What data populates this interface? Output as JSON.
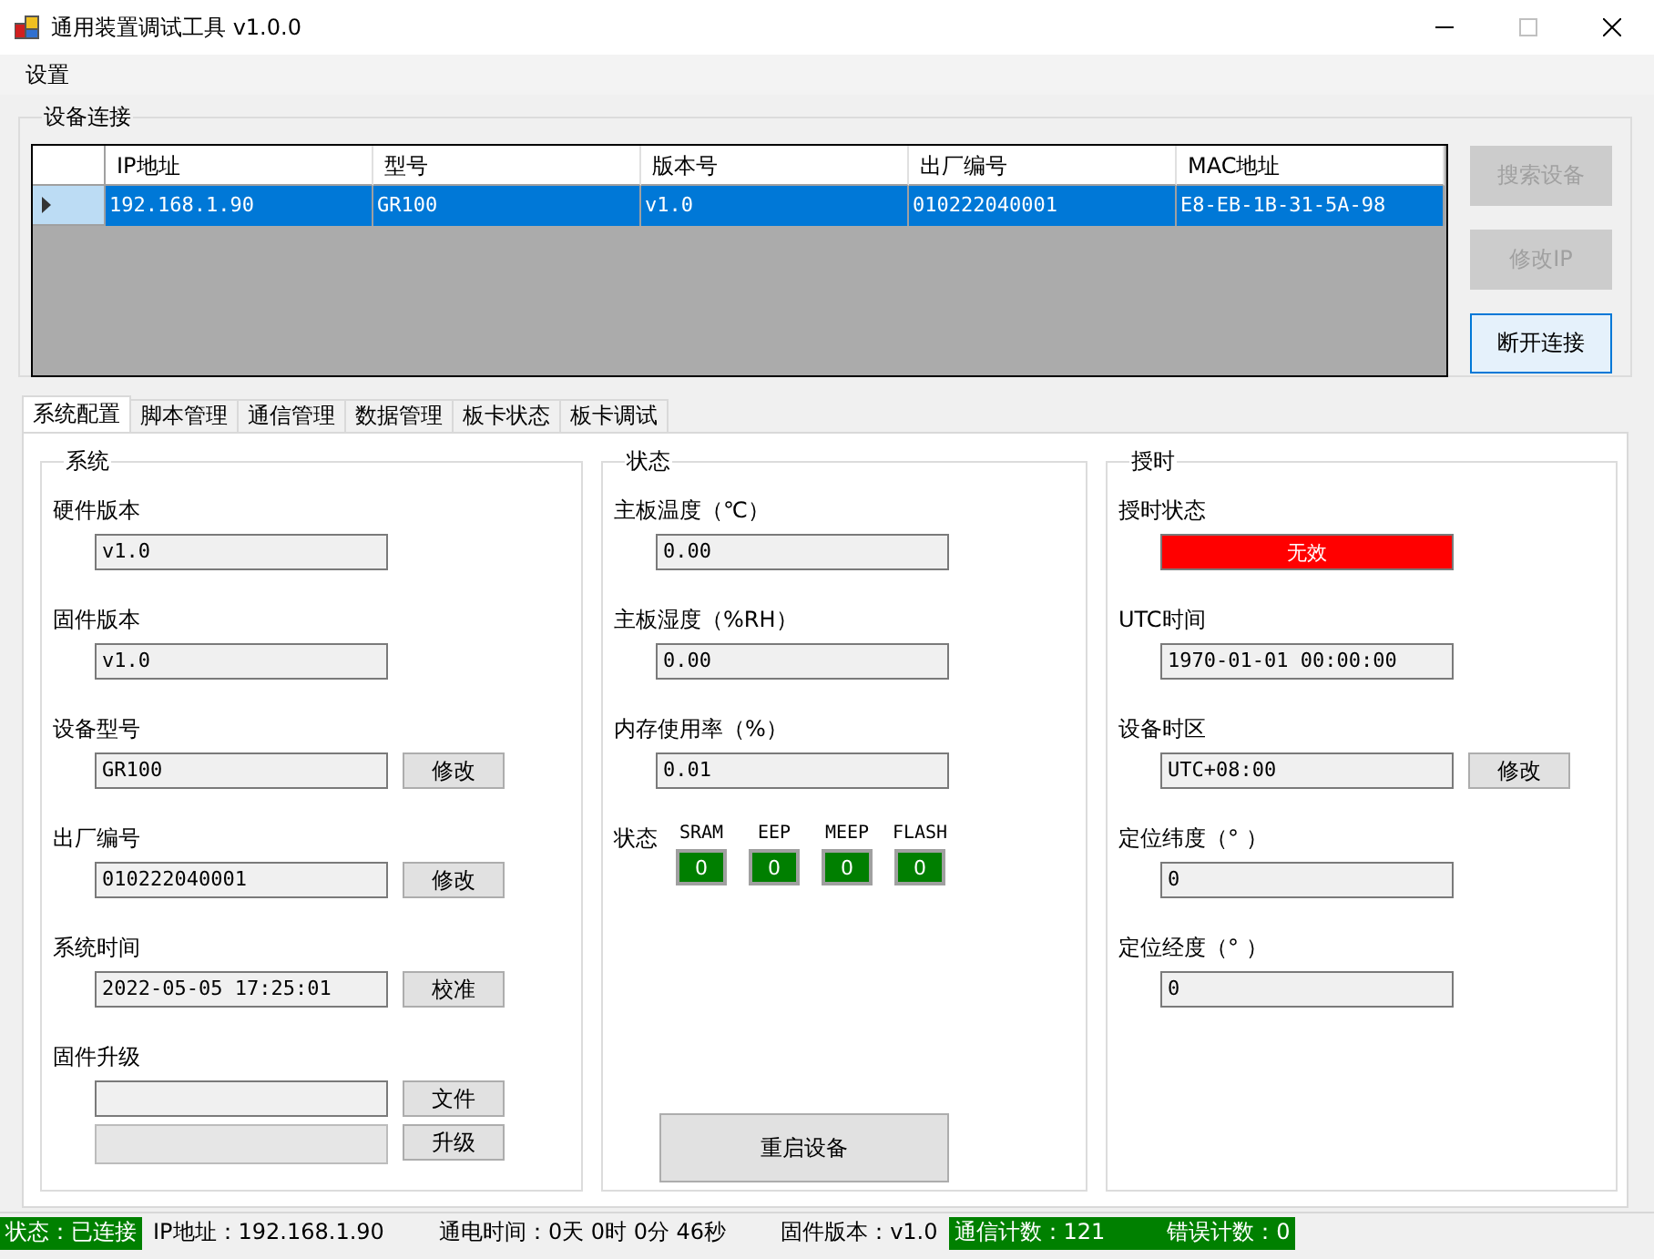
{
  "window": {
    "title": "通用装置调试工具 v1.0.0"
  },
  "menu": [
    "设置"
  ],
  "device_group": {
    "title": "设备连接",
    "table": {
      "columns": [
        "IP地址",
        "型号",
        "版本号",
        "出厂编号",
        "MAC地址"
      ],
      "rows": [
        {
          "selected": true,
          "cells": [
            "192.168.1.90",
            "GR100",
            "v1.0",
            "010222040001",
            "E8-EB-1B-31-5A-98"
          ]
        }
      ]
    },
    "buttons": [
      {
        "label": "搜索设备",
        "disabled": true
      },
      {
        "label": "修改IP",
        "disabled": true
      },
      {
        "label": "断开连接",
        "disabled": false
      }
    ]
  },
  "tabs": [
    {
      "label": "系统配置",
      "selected": true
    },
    {
      "label": "脚本管理",
      "selected": false
    },
    {
      "label": "通信管理",
      "selected": false
    },
    {
      "label": "数据管理",
      "selected": false
    },
    {
      "label": "板卡状态",
      "selected": false
    },
    {
      "label": "板卡调试",
      "selected": false
    }
  ],
  "system": {
    "title": "系统",
    "fields": [
      {
        "label": "硬件版本",
        "value": "v1.0"
      },
      {
        "label": "固件版本",
        "value": "v1.0"
      },
      {
        "label": "设备型号",
        "value": "GR100",
        "button": "修改"
      },
      {
        "label": "出厂编号",
        "value": "010222040001",
        "button": "修改"
      },
      {
        "label": "系统时间",
        "value": "2022-05-05 17:25:01",
        "button": "校准"
      }
    ],
    "upgrade": {
      "label": "固件升级",
      "file_button": "文件",
      "upgrade_button": "升级",
      "progress": {
        "level": 0
      }
    }
  },
  "status": {
    "title": "状态",
    "fields": [
      {
        "label": "主板温度（℃）",
        "value": "0.00"
      },
      {
        "label": "主板湿度（%RH）",
        "value": "0.00"
      },
      {
        "label": "内存使用率（%）",
        "value": "0.01"
      }
    ],
    "flags_label": "状态",
    "flags": [
      {
        "name": "SRAM",
        "value": "0",
        "color": "#007f00"
      },
      {
        "name": "EEP",
        "value": "0",
        "color": "#007f00"
      },
      {
        "name": "MEEP",
        "value": "0",
        "color": "#007f00"
      },
      {
        "name": "FLASH",
        "value": "0",
        "color": "#007f00"
      }
    ],
    "restart_button": "重启设备"
  },
  "timing": {
    "title": "授时",
    "state": {
      "label": "授时状态",
      "value": "无效",
      "color": "#ff0000"
    },
    "fields": [
      {
        "label": "UTC时间",
        "value": "1970-01-01 00:00:00"
      },
      {
        "label": "设备时区",
        "value": "UTC+08:00",
        "button": "修改"
      },
      {
        "label": "定位纬度（° ）",
        "value": "0"
      },
      {
        "label": "定位经度（° ）",
        "value": "0"
      }
    ]
  },
  "status_bar": [
    {
      "highlight": true,
      "items": [
        "状态：已连接"
      ]
    },
    {
      "highlight": false,
      "items": [
        "IP地址：192.168.1.90",
        "通电时间：0天 0时 0分 46秒",
        "固件版本：v1.0"
      ]
    },
    {
      "highlight": true,
      "items": [
        "通信计数：121",
        "错误计数：0"
      ]
    }
  ]
}
